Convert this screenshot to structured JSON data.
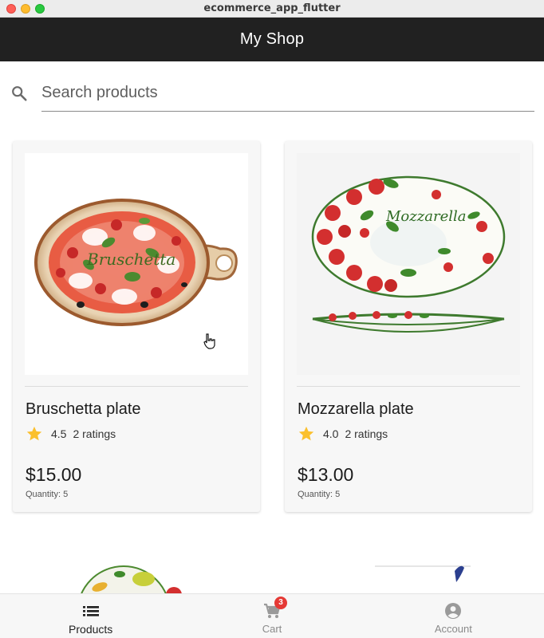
{
  "window": {
    "title": "ecommerce_app_flutter"
  },
  "appbar": {
    "title": "My Shop"
  },
  "search": {
    "placeholder": "Search products",
    "value": ""
  },
  "products": [
    {
      "name": "Bruschetta plate",
      "plate_text": "Bruschetta",
      "rating": "4.5",
      "ratings_label": "2 ratings",
      "price": "$15.00",
      "quantity": "Quantity: 5"
    },
    {
      "name": "Mozzarella plate",
      "plate_text": "Mozzarella",
      "rating": "4.0",
      "ratings_label": "2 ratings",
      "price": "$13.00",
      "quantity": "Quantity: 5"
    }
  ],
  "bottom_nav": {
    "items": [
      {
        "label": "Products",
        "icon": "list-icon",
        "active": true
      },
      {
        "label": "Cart",
        "icon": "cart-icon",
        "active": false,
        "badge": "3"
      },
      {
        "label": "Account",
        "icon": "account-circle-icon",
        "active": false
      }
    ]
  },
  "colors": {
    "appbar": "#212121",
    "star": "#fbc02d",
    "badge": "#e53935",
    "tomato": "#d32f2f",
    "basil": "#4c8a2f"
  }
}
